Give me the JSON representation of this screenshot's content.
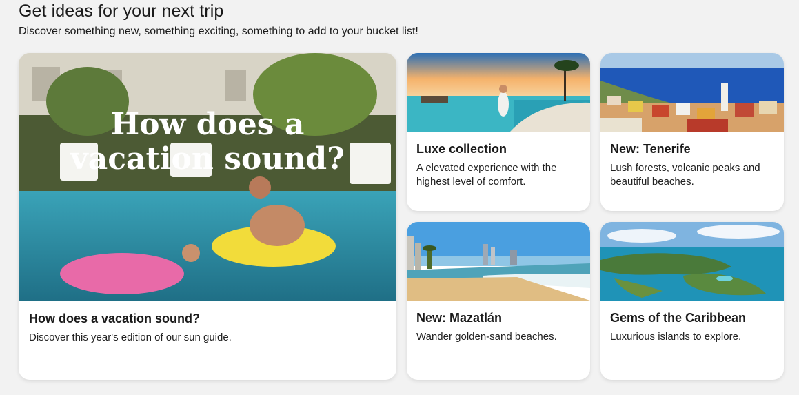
{
  "header": {
    "title": "Get ideas for your next trip",
    "subtitle": "Discover something new, something exciting, something to add to your bucket list!"
  },
  "cards": [
    {
      "title": "How does a vacation sound?",
      "description": "Discover this year's edition of our sun guide.",
      "image_text_line1": "How does a",
      "image_text_line2": "vacation sound?"
    },
    {
      "title": "Luxe collection",
      "description": "A elevated experience with the highest level of comfort."
    },
    {
      "title": "New: Tenerife",
      "description": "Lush forests, volcanic peaks and beautiful beaches."
    },
    {
      "title": "New: Mazatlán",
      "description": "Wander golden-sand beaches."
    },
    {
      "title": "Gems of the Caribbean",
      "description": "Luxurious islands to explore."
    }
  ]
}
